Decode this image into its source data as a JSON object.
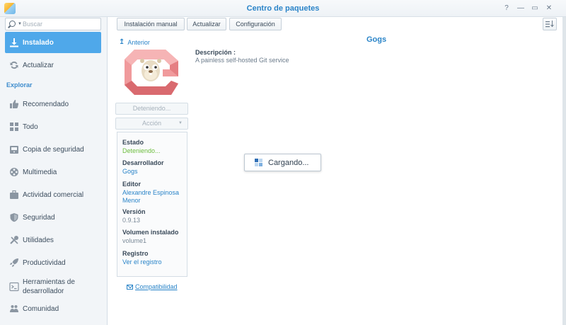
{
  "window": {
    "title": "Centro de paquetes"
  },
  "search": {
    "placeholder": "Buscar"
  },
  "sidebar": {
    "items": [
      {
        "label": "Instalado",
        "icon": "download-icon"
      },
      {
        "label": "Actualizar",
        "icon": "refresh-icon"
      },
      {
        "label": "Recomendado",
        "icon": "thumbs-up-icon"
      },
      {
        "label": "Todo",
        "icon": "grid-icon"
      },
      {
        "label": "Copia de seguridad",
        "icon": "backup-icon"
      },
      {
        "label": "Multimedia",
        "icon": "film-reel-icon"
      },
      {
        "label": "Actividad comercial",
        "icon": "briefcase-icon"
      },
      {
        "label": "Seguridad",
        "icon": "shield-icon"
      },
      {
        "label": "Utilidades",
        "icon": "tools-icon"
      },
      {
        "label": "Productividad",
        "icon": "rocket-icon"
      },
      {
        "label": "Herramientas de desarrollador",
        "icon": "terminal-icon"
      },
      {
        "label": "Comunidad",
        "icon": "people-icon"
      }
    ],
    "section_label": "Explorar"
  },
  "toolbar": {
    "manual_install": "Instalación manual",
    "update": "Actualizar",
    "settings": "Configuración"
  },
  "package": {
    "back_label": "Anterior",
    "name": "Gogs",
    "description_label": "Descripción :",
    "description": "A painless self-hosted Git service",
    "status_button": "Deteniendo...",
    "action_button": "Acción",
    "info": {
      "status_label": "Estado",
      "status_value": "Deteniendo...",
      "developer_label": "Desarrollador",
      "developer_value": "Gogs",
      "publisher_label": "Editor",
      "publisher_value": "Alexandre Espinosa Menor",
      "version_label": "Versión",
      "version_value": "0.9.13",
      "volume_label": "Volumen instalado",
      "volume_value": "volume1",
      "log_label": "Registro",
      "log_value": "Ver el registro"
    },
    "compatibility_link": "Compatibilidad"
  },
  "loading": {
    "text": "Cargando..."
  },
  "colors": {
    "accent": "#2a84c8",
    "active_item": "#4fa8ea",
    "status_green": "#6cbd3e",
    "logo_red": "#e8747a"
  }
}
